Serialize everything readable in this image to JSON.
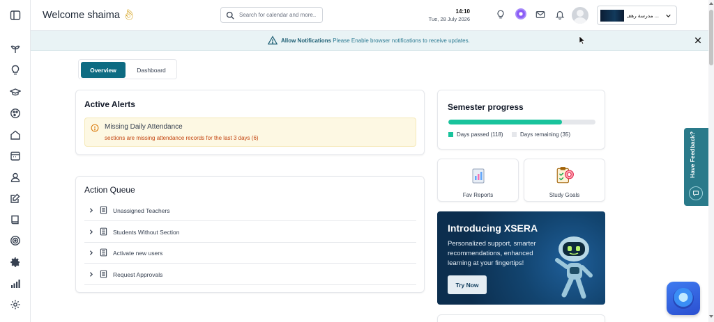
{
  "header": {
    "welcome": "Welcome shaima",
    "search_placeholder": "Search for calendar and more..",
    "time": "14:10",
    "date": "Tue, 28 July 2026",
    "school_name": "... مدرسة رهف"
  },
  "notification": {
    "title": "Allow Notifications",
    "message": "Please Enable browser notifications to receive updates."
  },
  "tabs": [
    {
      "label": "Overview",
      "active": true
    },
    {
      "label": "Dashboard",
      "active": false
    }
  ],
  "alerts": {
    "title": "Active Alerts",
    "items": [
      {
        "heading": "Missing Daily Attendance",
        "detail": "sections are missing attendance records for the last 3 days (6)"
      }
    ]
  },
  "action_queue": {
    "title": "Action Queue",
    "items": [
      {
        "label": "Unassigned Teachers"
      },
      {
        "label": "Students Without Section"
      },
      {
        "label": "Activate new users"
      },
      {
        "label": "Request Approvals"
      }
    ]
  },
  "semester": {
    "title": "Semester progress",
    "days_passed_label": "Days passed (118)",
    "days_remaining_label": "Days remaining (35)",
    "progress_fraction": 0.771,
    "colors": {
      "passed": "#19c39c",
      "remaining": "#e5e7eb"
    }
  },
  "tiles": [
    {
      "label": "Fav Reports",
      "icon": "report-icon"
    },
    {
      "label": "Study Goals",
      "icon": "goals-icon"
    }
  ],
  "promo": {
    "title": "Introducing XSERA",
    "text": "Personalized support, smarter recommendations, enhanced learning at your fingertips!",
    "button": "Try Now"
  },
  "feedback": {
    "label": "Have Feedback?"
  },
  "colors": {
    "primary": "#0d6b82",
    "alert_bg": "#fdf8e3",
    "alert_text": "#c2410c",
    "notif_bg": "#e9f3f5"
  }
}
